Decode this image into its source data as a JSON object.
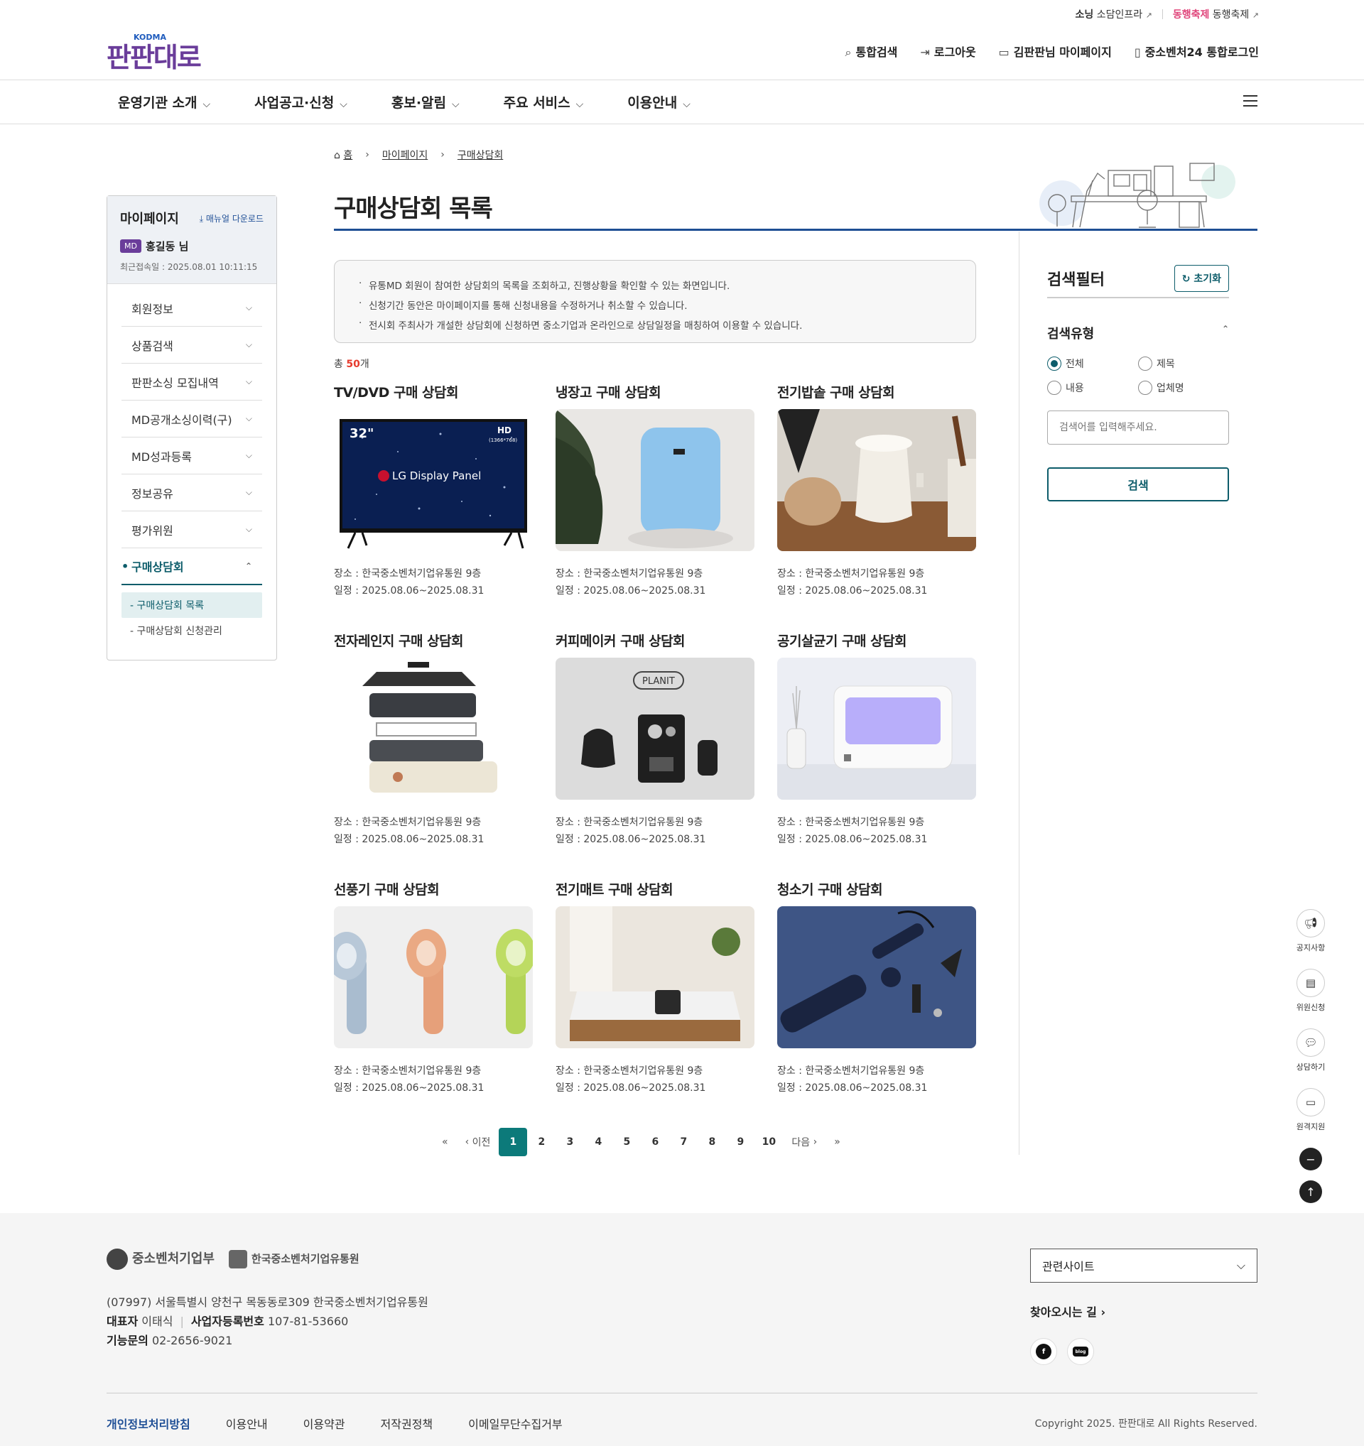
{
  "utility": {
    "link1_logo": "소닝",
    "link1_label": "소담인프라",
    "link2_logo": "동행축제",
    "link2_label": "동행축제"
  },
  "header": {
    "logo": "판판대로",
    "logo_brand": "KODMA",
    "top_links": [
      "통합검색",
      "로그아웃",
      "김판판님 마이페이지",
      "중소벤처24 통합로그인"
    ]
  },
  "main_nav": [
    "운영기관 소개",
    "사업공고·신청",
    "홍보·알림",
    "주요 서비스",
    "이용안내"
  ],
  "breadcrumb": {
    "home": "홈",
    "level1": "마이페이지",
    "level2": "구매상담회"
  },
  "page_title": "구매상담회 목록",
  "sidebar": {
    "title": "마이페이지",
    "manual": "매뉴얼 다운로드",
    "badge": "MD",
    "user": "홍길동 님",
    "last_login": "최근접속일 : 2025.08.01 10:11:15",
    "items": [
      "회원정보",
      "상품검색",
      "판판소싱 모집내역",
      "MD공개소싱이력(구)",
      "MD성과등록",
      "정보공유",
      "평가위원",
      "구매상담회"
    ],
    "sub_items": [
      "- 구매상담회 목록",
      "- 구매상담회 신청관리"
    ]
  },
  "notice": [
    "유통MD 회원이 참여한 상담회의 목록을 조회하고, 진행상황을 확인할 수 있는 화면입니다.",
    "신청기간 동안은 마이페이지를 통해 신청내용을 수정하거나 취소할 수 있습니다.",
    "전시회 주최사가 개설한 상담회에 신청하면 중소기업과 온라인으로 상담일정을 매칭하여 이용할 수 있습니다."
  ],
  "total": {
    "prefix": "총 ",
    "count": "50",
    "suffix": "개"
  },
  "cards": [
    {
      "title": "TV/DVD 구매 상담회",
      "place": "장소 : 한국중소벤처기업유통원 9층",
      "date": "일정 : 2025.08.06~2025.08.31"
    },
    {
      "title": "냉장고 구매 상담회",
      "place": "장소 : 한국중소벤처기업유통원 9층",
      "date": "일정 : 2025.08.06~2025.08.31"
    },
    {
      "title": "전기밥솥 구매 상담회",
      "place": "장소 : 한국중소벤처기업유통원 9층",
      "date": "일정 : 2025.08.06~2025.08.31"
    },
    {
      "title": "전자레인지 구매 상담회",
      "place": "장소 : 한국중소벤처기업유통원 9층",
      "date": "일정 : 2025.08.06~2025.08.31"
    },
    {
      "title": "커피메이커 구매 상담회",
      "place": "장소 : 한국중소벤처기업유통원 9층",
      "date": "일정 : 2025.08.06~2025.08.31"
    },
    {
      "title": "공기살균기 구매 상담회",
      "place": "장소 : 한국중소벤처기업유통원 9층",
      "date": "일정 : 2025.08.06~2025.08.31"
    },
    {
      "title": "선풍기 구매 상담회",
      "place": "장소 : 한국중소벤처기업유통원 9층",
      "date": "일정 : 2025.08.06~2025.08.31"
    },
    {
      "title": "전기매트 구매 상담회",
      "place": "장소 : 한국중소벤처기업유통원 9층",
      "date": "일정 : 2025.08.06~2025.08.31"
    },
    {
      "title": "청소기 구매 상담회",
      "place": "장소 : 한국중소벤처기업유통원 9층",
      "date": "일정 : 2025.08.06~2025.08.31"
    }
  ],
  "card_images": {
    "tv_text_size": "32\"",
    "tv_text_hd": "HD",
    "tv_text_res": "(1366*768)",
    "tv_text_brand": "LG Display Panel",
    "coffee_brand": "PLANIT"
  },
  "pagination": {
    "first": "«",
    "prev": "이전",
    "pages": [
      "1",
      "2",
      "3",
      "4",
      "5",
      "6",
      "7",
      "8",
      "9",
      "10"
    ],
    "next": "다음",
    "last": "»",
    "current": "1"
  },
  "filter": {
    "title": "검색필터",
    "reset": "초기화",
    "type_label": "검색유형",
    "options": [
      "전체",
      "제목",
      "내용",
      "업체명"
    ],
    "selected": "전체",
    "placeholder": "검색어를 입력해주세요.",
    "search": "검색"
  },
  "quick_menu": [
    "공지사항",
    "위원신청",
    "상담하기",
    "원격지원"
  ],
  "footer": {
    "logo1": "중소벤처기업부",
    "logo2": "한국중소벤처기업유통원",
    "address": "(07997) 서울특별시 양천구 목동동로309 한국중소벤처기업유통원",
    "rep_label": "대표자",
    "rep": "이태식",
    "biz_label": "사업자등록번호",
    "biz": "107-81-53660",
    "contact_label": "기능문의",
    "contact": "02-2656-9021",
    "related": "관련사이트",
    "directions": "찾아오시는 길",
    "sns": [
      "f",
      "blog"
    ],
    "links": [
      "개인정보처리방침",
      "이용안내",
      "이용약관",
      "저작권정책",
      "이메일무단수집거부"
    ],
    "copyright": "Copyright 2025. 판판대로 All Rights Reserved."
  },
  "colors": {
    "brand_purple": "#6a3d9a",
    "teal": "#0c5c6a",
    "navy": "#1e4f94",
    "accent_red": "#e63b2e"
  }
}
